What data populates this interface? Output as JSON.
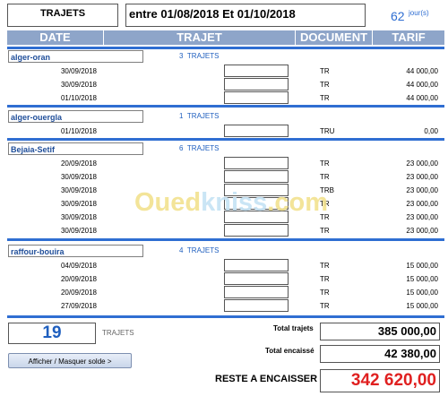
{
  "top": {
    "title": "TRAJETS",
    "period": "entre 01/08/2018 Et 01/10/2018",
    "days_value": "62",
    "days_unit": "jour(s)"
  },
  "columns": [
    "DATE",
    "TRAJET",
    "DOCUMENT",
    "TARIF"
  ],
  "groups": [
    {
      "name": "alger-oran",
      "count": "3",
      "count_label": "TRAJETS",
      "rows": [
        {
          "date": "30/09/2018",
          "doc": "TR",
          "price": "44 000,00"
        },
        {
          "date": "30/09/2018",
          "doc": "TR",
          "price": "44 000,00"
        },
        {
          "date": "01/10/2018",
          "doc": "TR",
          "price": "44 000,00"
        }
      ]
    },
    {
      "name": "alger-ouergla",
      "count": "1",
      "count_label": "TRAJETS",
      "rows": [
        {
          "date": "01/10/2018",
          "doc": "TRU",
          "price": "0,00"
        }
      ]
    },
    {
      "name": "Bejaia-Setif",
      "count": "6",
      "count_label": "TRAJETS",
      "rows": [
        {
          "date": "20/09/2018",
          "doc": "TR",
          "price": "23 000,00"
        },
        {
          "date": "30/09/2018",
          "doc": "TR",
          "price": "23 000,00"
        },
        {
          "date": "30/09/2018",
          "doc": "TRB",
          "price": "23 000,00"
        },
        {
          "date": "30/09/2018",
          "doc": "TR",
          "price": "23 000,00"
        },
        {
          "date": "30/09/2018",
          "doc": "TR",
          "price": "23 000,00"
        },
        {
          "date": "30/09/2018",
          "doc": "TR",
          "price": "23 000,00"
        }
      ]
    },
    {
      "name": "raffour-bouira",
      "count": "4",
      "count_label": "TRAJETS",
      "rows": [
        {
          "date": "04/09/2018",
          "doc": "TR",
          "price": "15 000,00"
        },
        {
          "date": "20/09/2018",
          "doc": "TR",
          "price": "15 000,00"
        },
        {
          "date": "20/09/2018",
          "doc": "TR",
          "price": "15 000,00"
        },
        {
          "date": "27/09/2018",
          "doc": "TR",
          "price": "15 000,00"
        }
      ]
    }
  ],
  "footer": {
    "total_count": "19",
    "total_count_label": "TRAJETS",
    "toggle_button": "Afficher / Masquer solde >",
    "total_trajets_label": "Total trajets",
    "total_trajets_value": "385 000,00",
    "total_encaisse_label": "Total  encaissé",
    "total_encaisse_value": "42 380,00",
    "reste_label": "RESTE A ENCAISSER",
    "reste_value": "342 620,00"
  },
  "watermark": {
    "part1": "Oued",
    "part2": "kniss",
    "part3": ".com"
  },
  "colors": {
    "header_bg": "#8ea5c9",
    "separator": "#2f6ed2",
    "group_text": "#1f4e9a",
    "reste": "#e02020",
    "count_blue": "#1f5fbf"
  }
}
